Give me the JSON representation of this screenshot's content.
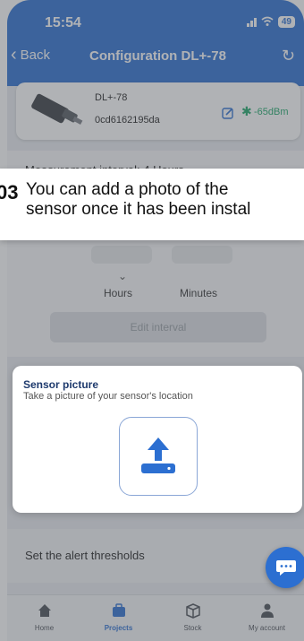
{
  "status_bar": {
    "time": "15:54",
    "battery": "49"
  },
  "header": {
    "back_label": "Back",
    "title": "Configuration DL+-78"
  },
  "device": {
    "name": "DL+-78",
    "id": "0cd6162195da",
    "signal": "-65dBm"
  },
  "measurement": {
    "label": "Measurement interval: 4 Hours",
    "hours_label": "Hours",
    "minutes_label": "Minutes",
    "edit_button": "Edit interval"
  },
  "tutorial": {
    "step": "03",
    "text_line1": "You can add a photo of the",
    "text_line2": "sensor once it has been instal"
  },
  "sensor_picture": {
    "title": "Sensor picture",
    "subtitle": "Take a picture of your sensor's location"
  },
  "alerts": {
    "label": "Set the alert thresholds"
  },
  "nav": {
    "items": [
      {
        "label": "Home",
        "icon": "home-icon"
      },
      {
        "label": "Projects",
        "icon": "briefcase-icon",
        "active": true
      },
      {
        "label": "Stock",
        "icon": "box-icon"
      },
      {
        "label": "My account",
        "icon": "user-icon"
      }
    ]
  },
  "colors": {
    "primary": "#2c6fd1",
    "signal": "#1fa86a"
  }
}
